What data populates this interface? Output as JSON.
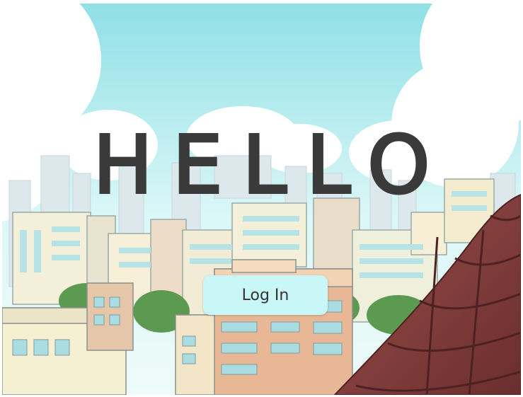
{
  "hero": {
    "title": "HELLO"
  },
  "login": {
    "label": "Log In"
  },
  "colors": {
    "sky_top": "#8fe0e6",
    "sky_bottom": "#dcf7f7",
    "button_bg": "#c9f6f6",
    "title_text": "#3a3a3a",
    "roof": "#7a3a3a"
  },
  "icons": [
    "city-illustration",
    "roof-tiles"
  ]
}
